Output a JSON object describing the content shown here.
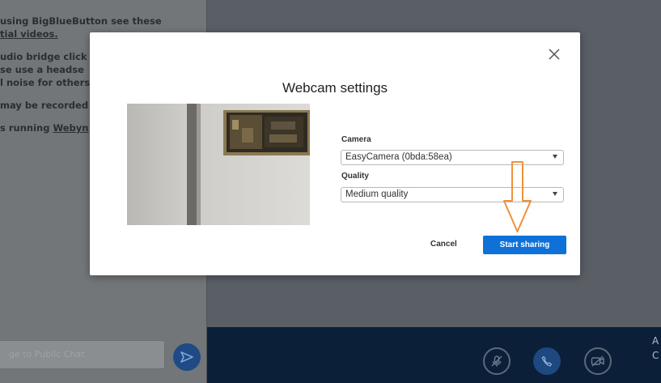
{
  "chat": {
    "messages": [
      "using BigBlueButton see these",
      "tial videos.",
      "udio bridge click",
      "se use a headse",
      "l noise for others",
      "may be recorded",
      "s running "
    ],
    "link_text": "Webyn",
    "input_placeholder": "ge to Public Chat",
    "send_icon": "send-arrow-icon"
  },
  "action_bar": {
    "edge_text_1": "A",
    "edge_text_2": "C",
    "buttons": [
      "mic-muted-icon",
      "phone-icon",
      "camera-off-icon"
    ]
  },
  "modal": {
    "title": "Webcam settings",
    "close_icon": "close-icon",
    "camera_label": "Camera",
    "camera_value": "EasyCamera (0bda:58ea)",
    "quality_label": "Quality",
    "quality_value": "Medium quality",
    "cancel_label": "Cancel",
    "start_label": "Start sharing",
    "annotation_color": "#f0913a",
    "primary_color": "#0f70d7"
  }
}
